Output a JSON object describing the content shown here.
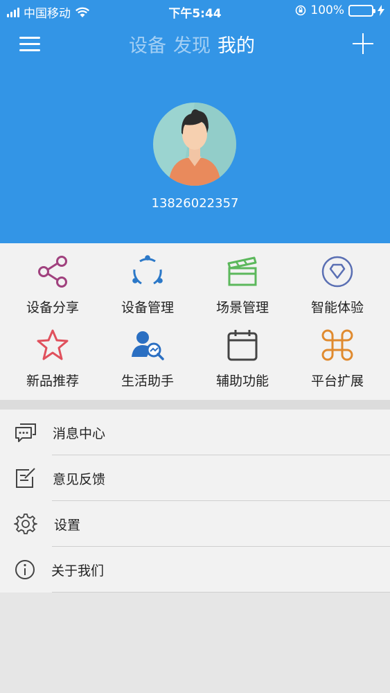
{
  "status_bar": {
    "carrier": "中国移动",
    "time": "下午5:44",
    "battery_percent": "100%"
  },
  "header": {
    "tabs": [
      "设备",
      "发现",
      "我的"
    ],
    "active_tab": "我的",
    "phone": "13826022357",
    "background_color": "#3395e6"
  },
  "grid": {
    "items": [
      {
        "label": "设备分享",
        "icon": "share-icon"
      },
      {
        "label": "设备管理",
        "icon": "device-management-icon"
      },
      {
        "label": "场景管理",
        "icon": "clapperboard-icon"
      },
      {
        "label": "智能体验",
        "icon": "diamond-icon"
      },
      {
        "label": "新品推荐",
        "icon": "star-icon"
      },
      {
        "label": "生活助手",
        "icon": "assistant-search-icon"
      },
      {
        "label": "辅助功能",
        "icon": "calendar-icon"
      },
      {
        "label": "平台扩展",
        "icon": "command-key-icon"
      }
    ]
  },
  "list": {
    "items": [
      {
        "label": "消息中心",
        "icon": "chat-bubble-icon"
      },
      {
        "label": "意见反馈",
        "icon": "edit-note-icon"
      },
      {
        "label": "设置",
        "icon": "gear-icon"
      },
      {
        "label": "关于我们",
        "icon": "info-icon"
      }
    ]
  }
}
